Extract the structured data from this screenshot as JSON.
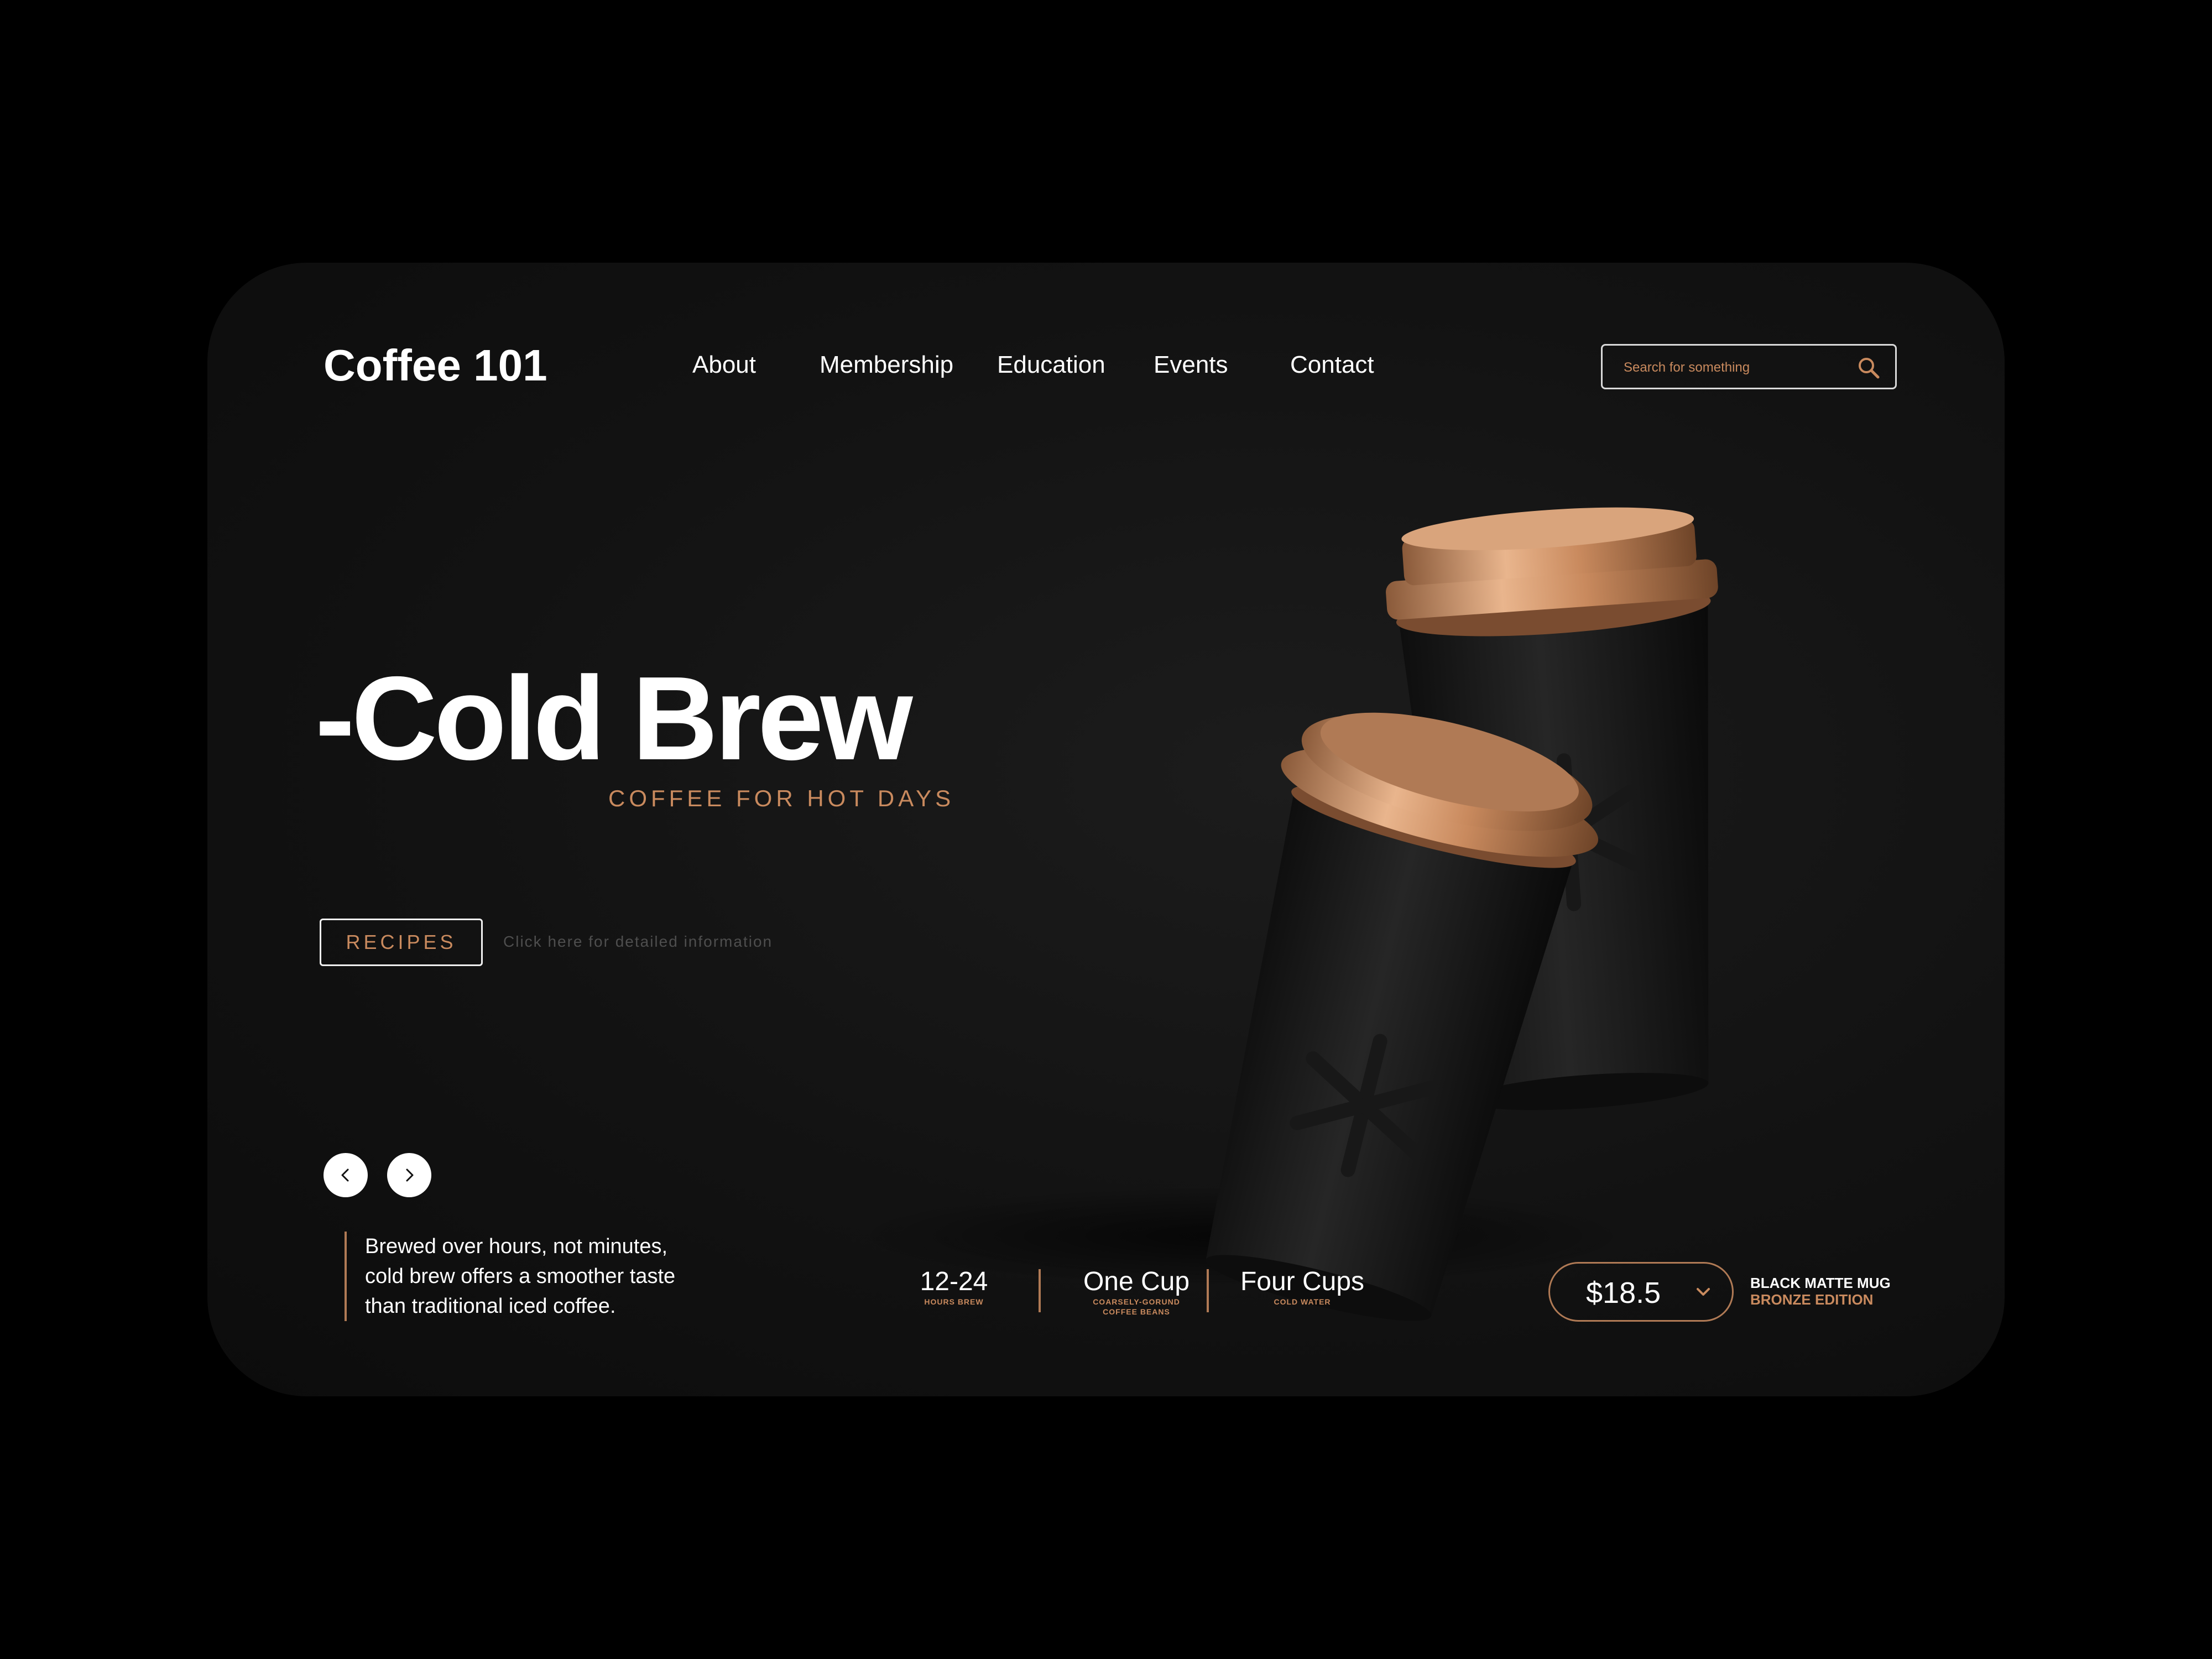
{
  "brand": {
    "name": "Coffee 101"
  },
  "nav": {
    "items": [
      {
        "label": "About"
      },
      {
        "label": "Membership"
      },
      {
        "label": "Education"
      },
      {
        "label": "Events"
      },
      {
        "label": "Contact"
      }
    ]
  },
  "search": {
    "placeholder": "Search for something",
    "icon": "search-icon"
  },
  "hero": {
    "title": "-Cold Brew",
    "subtitle": "COFFEE FOR HOT DAYS",
    "cta_label": "RECIPES",
    "cta_hint": "Click here for detailed information"
  },
  "carousel": {
    "prev_icon": "chevron-left-icon",
    "next_icon": "chevron-right-icon"
  },
  "description": {
    "line1": "Brewed over hours, not minutes,",
    "line2": "cold brew offers a smoother taste",
    "line3": "than  traditional iced coffee."
  },
  "stats": [
    {
      "value": "12-24",
      "label": "HOURS BREW"
    },
    {
      "value": "One Cup",
      "label": "COARSELY-GORUND",
      "label2": "COFFEE BEANS"
    },
    {
      "value": "Four Cups",
      "label": "COLD WATER"
    }
  ],
  "product": {
    "price": "$18.5",
    "name_line1": "BLACK MATTE MUG",
    "name_line2": "BRONZE EDITION",
    "dropdown_icon": "chevron-down-icon"
  },
  "colors": {
    "accent": "#c98a5e",
    "background": "#121212",
    "text": "#ffffff"
  }
}
